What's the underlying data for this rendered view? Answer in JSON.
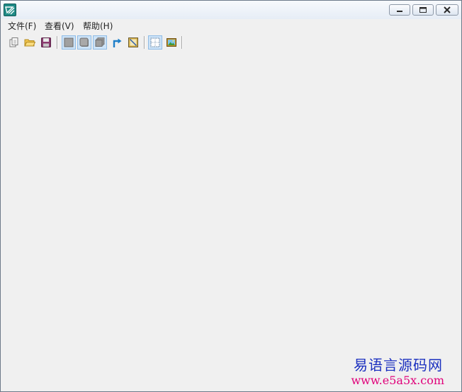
{
  "menubar": {
    "file": "文件(F)",
    "view": "查看(V)",
    "help": "帮助(H)"
  },
  "toolbar": {
    "buttons": [
      {
        "icon": "new-file-icon",
        "active": false
      },
      {
        "icon": "open-folder-icon",
        "active": false
      },
      {
        "icon": "save-disk-icon",
        "active": false
      },
      {
        "icon": "layer-square-icon",
        "active": true
      },
      {
        "icon": "layer-rounded-icon",
        "active": true
      },
      {
        "icon": "layer-stack-icon",
        "active": true
      },
      {
        "icon": "blue-arrow-icon",
        "active": false
      },
      {
        "icon": "picture-frame-icon",
        "active": false
      },
      {
        "icon": "grid-frame-icon",
        "active": true
      },
      {
        "icon": "landscape-image-icon",
        "active": false
      }
    ]
  },
  "watermark": {
    "title": "易语言源码网",
    "url": "www.e5a5x.com",
    "title_color": "#1a2fbf",
    "url_color": "#e0007a"
  }
}
